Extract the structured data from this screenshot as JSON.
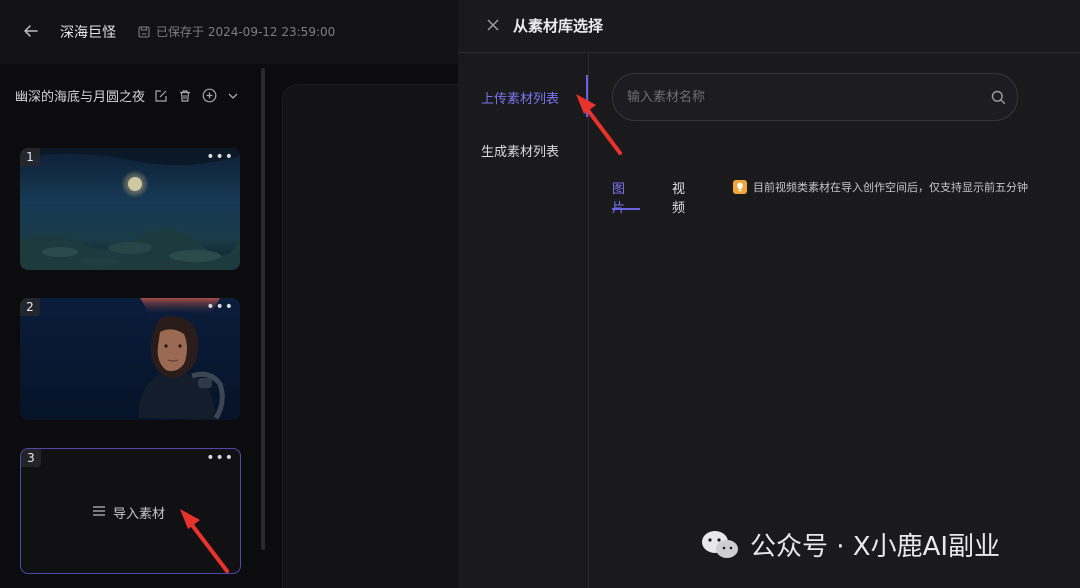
{
  "editor": {
    "project_title": "深海巨怪",
    "save_status": "已保存于 2024-09-12 23:59:00",
    "scene_title": "幽深的海底与月圆之夜",
    "cards": [
      {
        "number": "1",
        "more": "•••"
      },
      {
        "number": "2",
        "more": "•••"
      },
      {
        "number": "3",
        "more": "•••",
        "import_label": "导入素材"
      }
    ]
  },
  "panel": {
    "title": "从素材库选择",
    "nav": [
      {
        "label": "上传素材列表",
        "active": true
      },
      {
        "label": "生成素材列表",
        "active": false
      }
    ],
    "search": {
      "placeholder": "输入素材名称",
      "value": ""
    },
    "tabs": [
      {
        "label": "图片",
        "active": true
      },
      {
        "label": "视频",
        "active": false
      }
    ],
    "notice": "目前视频类素材在导入创作空间后，仅支持显示前五分钟"
  },
  "watermark": {
    "text": "公众号 · X小鹿AI副业"
  },
  "colors": {
    "accent": "#6a63e8",
    "arrow": "#e8322c",
    "notice_icon": "#f0a73a"
  },
  "icons": [
    "back-arrow-icon",
    "save-icon",
    "edit-icon",
    "trash-icon",
    "add-circle-icon",
    "chevron-down-icon",
    "more-icon",
    "list-icon",
    "close-icon",
    "search-icon",
    "lightbulb-icon",
    "wechat-icon"
  ]
}
